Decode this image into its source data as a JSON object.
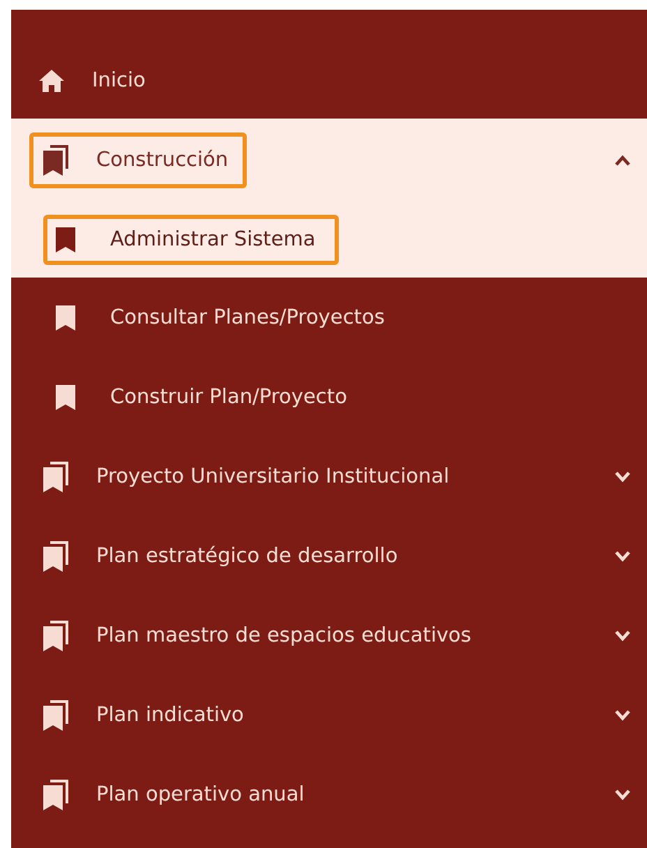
{
  "menu": [
    {
      "kind": "link",
      "label": "Inicio"
    },
    {
      "kind": "group",
      "label": "Construcción",
      "expanded": true,
      "highlighted": true,
      "children": [
        {
          "label": "Administrar Sistema",
          "selected": true,
          "highlighted": true
        },
        {
          "label": "Consultar Planes/Proyectos",
          "selected": false,
          "highlighted": false
        },
        {
          "label": "Construir Plan/Proyecto",
          "selected": false,
          "highlighted": false
        }
      ]
    },
    {
      "kind": "group",
      "label": "Proyecto Universitario Institucional",
      "expanded": false,
      "highlighted": false
    },
    {
      "kind": "group",
      "label": "Plan estratégico de desarrollo",
      "expanded": false,
      "highlighted": false
    },
    {
      "kind": "group",
      "label": "Plan maestro de espacios educativos",
      "expanded": false,
      "highlighted": false
    },
    {
      "kind": "group",
      "label": "Plan indicativo",
      "expanded": false,
      "highlighted": false
    },
    {
      "kind": "group",
      "label": "Plan operativo anual",
      "expanded": false,
      "highlighted": false
    }
  ]
}
